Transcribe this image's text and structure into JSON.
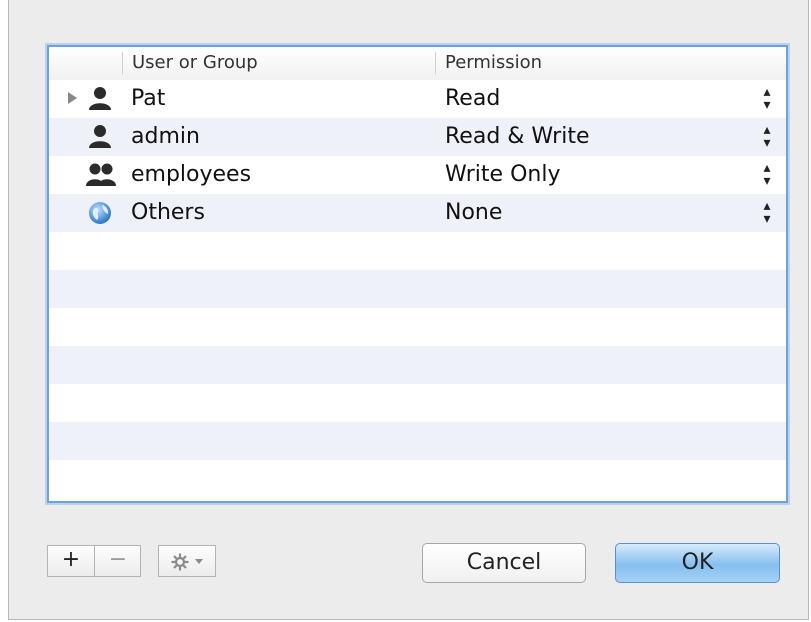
{
  "table": {
    "columns": [
      "User or Group",
      "Permission"
    ],
    "rows": [
      {
        "name": "Pat",
        "permission": "Read",
        "icon": "user-icon",
        "expandable": true
      },
      {
        "name": "admin",
        "permission": "Read & Write",
        "icon": "user-icon",
        "expandable": false
      },
      {
        "name": "employees",
        "permission": "Write Only",
        "icon": "group-icon",
        "expandable": false
      },
      {
        "name": "Others",
        "permission": "None",
        "icon": "globe-icon",
        "expandable": false
      }
    ]
  },
  "toolbar": {
    "add_label": "+",
    "remove_label": "−",
    "gear_icon": "gear-icon"
  },
  "buttons": {
    "cancel_label": "Cancel",
    "ok_label": "OK"
  },
  "colors": {
    "focus_ring": "#6fa3d8",
    "ok_button": "#86bff0",
    "alt_row": "#eef2f8"
  }
}
